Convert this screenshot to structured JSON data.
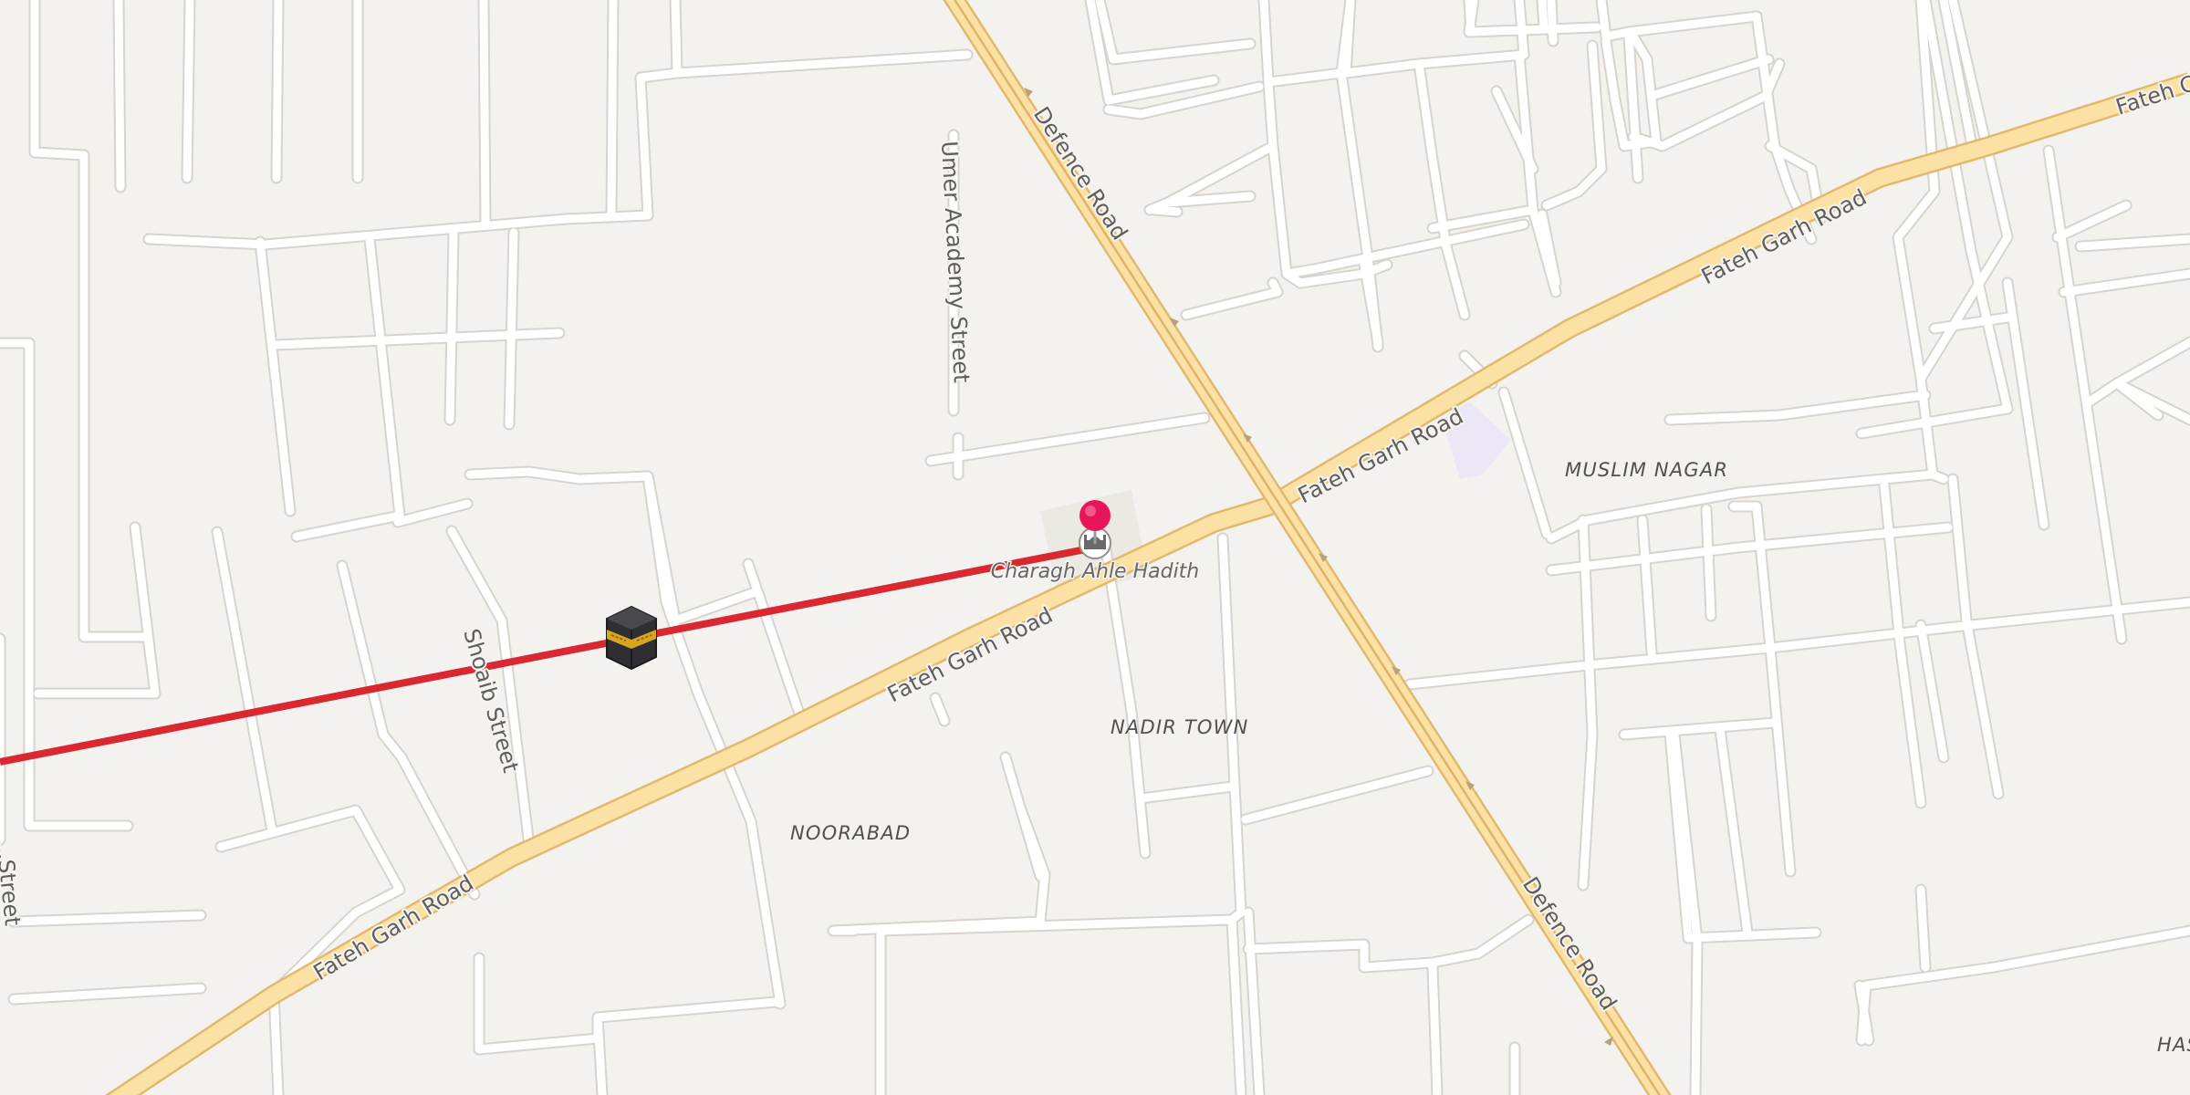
{
  "map": {
    "roads": {
      "defence_road_north": "Defence Road",
      "defence_road_south": "Defence Road",
      "fateh_garh_road_ne": "Fateh Garh Road",
      "fateh_garh_road_mid": "Fateh Garh Road",
      "fateh_garh_road_center": "Fateh Garh Road",
      "fateh_garh_road_sw": "Fateh Garh Road",
      "fateh_garh_road_edge": "Fateh C",
      "umer_academy_street": "Umer Academy Street",
      "shoaib_street": "Shoaib Street",
      "left_edge_street": "...Street"
    },
    "areas": {
      "muslim_nagar": "MUSLIM NAGAR",
      "nadir_town": "NADIR TOWN",
      "noorabad": "NOORABAD",
      "has_edge": "HAS"
    },
    "poi": {
      "mosque_name": "Charagh Ahle Hadith",
      "mosque_icon": "mosque-icon",
      "pin_icon": "location-pin-icon",
      "kaaba_icon": "kaaba-icon"
    },
    "colors": {
      "background": "#f4f2ef",
      "major_road": "#fbe2a4",
      "major_road_casing": "#e2b86f",
      "qibla_line": "#d9282f",
      "pin": "#e8155b"
    }
  }
}
